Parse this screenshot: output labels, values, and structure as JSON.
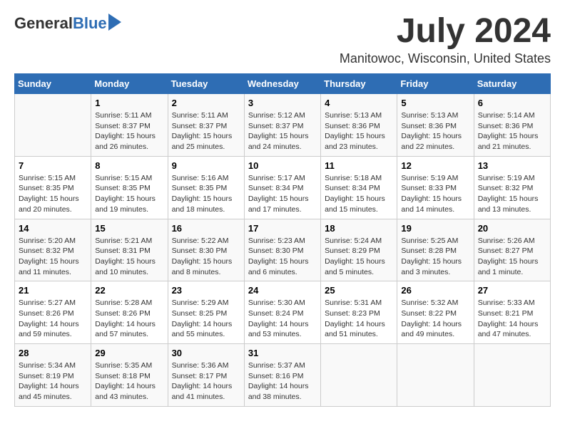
{
  "header": {
    "logo_general": "General",
    "logo_blue": "Blue",
    "month_title": "July 2024",
    "location": "Manitowoc, Wisconsin, United States"
  },
  "weekdays": [
    "Sunday",
    "Monday",
    "Tuesday",
    "Wednesday",
    "Thursday",
    "Friday",
    "Saturday"
  ],
  "weeks": [
    [
      {
        "day": "",
        "sunrise": "",
        "sunset": "",
        "daylight": ""
      },
      {
        "day": "1",
        "sunrise": "Sunrise: 5:11 AM",
        "sunset": "Sunset: 8:37 PM",
        "daylight": "Daylight: 15 hours and 26 minutes."
      },
      {
        "day": "2",
        "sunrise": "Sunrise: 5:11 AM",
        "sunset": "Sunset: 8:37 PM",
        "daylight": "Daylight: 15 hours and 25 minutes."
      },
      {
        "day": "3",
        "sunrise": "Sunrise: 5:12 AM",
        "sunset": "Sunset: 8:37 PM",
        "daylight": "Daylight: 15 hours and 24 minutes."
      },
      {
        "day": "4",
        "sunrise": "Sunrise: 5:13 AM",
        "sunset": "Sunset: 8:36 PM",
        "daylight": "Daylight: 15 hours and 23 minutes."
      },
      {
        "day": "5",
        "sunrise": "Sunrise: 5:13 AM",
        "sunset": "Sunset: 8:36 PM",
        "daylight": "Daylight: 15 hours and 22 minutes."
      },
      {
        "day": "6",
        "sunrise": "Sunrise: 5:14 AM",
        "sunset": "Sunset: 8:36 PM",
        "daylight": "Daylight: 15 hours and 21 minutes."
      }
    ],
    [
      {
        "day": "7",
        "sunrise": "Sunrise: 5:15 AM",
        "sunset": "Sunset: 8:35 PM",
        "daylight": "Daylight: 15 hours and 20 minutes."
      },
      {
        "day": "8",
        "sunrise": "Sunrise: 5:15 AM",
        "sunset": "Sunset: 8:35 PM",
        "daylight": "Daylight: 15 hours and 19 minutes."
      },
      {
        "day": "9",
        "sunrise": "Sunrise: 5:16 AM",
        "sunset": "Sunset: 8:35 PM",
        "daylight": "Daylight: 15 hours and 18 minutes."
      },
      {
        "day": "10",
        "sunrise": "Sunrise: 5:17 AM",
        "sunset": "Sunset: 8:34 PM",
        "daylight": "Daylight: 15 hours and 17 minutes."
      },
      {
        "day": "11",
        "sunrise": "Sunrise: 5:18 AM",
        "sunset": "Sunset: 8:34 PM",
        "daylight": "Daylight: 15 hours and 15 minutes."
      },
      {
        "day": "12",
        "sunrise": "Sunrise: 5:19 AM",
        "sunset": "Sunset: 8:33 PM",
        "daylight": "Daylight: 15 hours and 14 minutes."
      },
      {
        "day": "13",
        "sunrise": "Sunrise: 5:19 AM",
        "sunset": "Sunset: 8:32 PM",
        "daylight": "Daylight: 15 hours and 13 minutes."
      }
    ],
    [
      {
        "day": "14",
        "sunrise": "Sunrise: 5:20 AM",
        "sunset": "Sunset: 8:32 PM",
        "daylight": "Daylight: 15 hours and 11 minutes."
      },
      {
        "day": "15",
        "sunrise": "Sunrise: 5:21 AM",
        "sunset": "Sunset: 8:31 PM",
        "daylight": "Daylight: 15 hours and 10 minutes."
      },
      {
        "day": "16",
        "sunrise": "Sunrise: 5:22 AM",
        "sunset": "Sunset: 8:30 PM",
        "daylight": "Daylight: 15 hours and 8 minutes."
      },
      {
        "day": "17",
        "sunrise": "Sunrise: 5:23 AM",
        "sunset": "Sunset: 8:30 PM",
        "daylight": "Daylight: 15 hours and 6 minutes."
      },
      {
        "day": "18",
        "sunrise": "Sunrise: 5:24 AM",
        "sunset": "Sunset: 8:29 PM",
        "daylight": "Daylight: 15 hours and 5 minutes."
      },
      {
        "day": "19",
        "sunrise": "Sunrise: 5:25 AM",
        "sunset": "Sunset: 8:28 PM",
        "daylight": "Daylight: 15 hours and 3 minutes."
      },
      {
        "day": "20",
        "sunrise": "Sunrise: 5:26 AM",
        "sunset": "Sunset: 8:27 PM",
        "daylight": "Daylight: 15 hours and 1 minute."
      }
    ],
    [
      {
        "day": "21",
        "sunrise": "Sunrise: 5:27 AM",
        "sunset": "Sunset: 8:26 PM",
        "daylight": "Daylight: 14 hours and 59 minutes."
      },
      {
        "day": "22",
        "sunrise": "Sunrise: 5:28 AM",
        "sunset": "Sunset: 8:26 PM",
        "daylight": "Daylight: 14 hours and 57 minutes."
      },
      {
        "day": "23",
        "sunrise": "Sunrise: 5:29 AM",
        "sunset": "Sunset: 8:25 PM",
        "daylight": "Daylight: 14 hours and 55 minutes."
      },
      {
        "day": "24",
        "sunrise": "Sunrise: 5:30 AM",
        "sunset": "Sunset: 8:24 PM",
        "daylight": "Daylight: 14 hours and 53 minutes."
      },
      {
        "day": "25",
        "sunrise": "Sunrise: 5:31 AM",
        "sunset": "Sunset: 8:23 PM",
        "daylight": "Daylight: 14 hours and 51 minutes."
      },
      {
        "day": "26",
        "sunrise": "Sunrise: 5:32 AM",
        "sunset": "Sunset: 8:22 PM",
        "daylight": "Daylight: 14 hours and 49 minutes."
      },
      {
        "day": "27",
        "sunrise": "Sunrise: 5:33 AM",
        "sunset": "Sunset: 8:21 PM",
        "daylight": "Daylight: 14 hours and 47 minutes."
      }
    ],
    [
      {
        "day": "28",
        "sunrise": "Sunrise: 5:34 AM",
        "sunset": "Sunset: 8:19 PM",
        "daylight": "Daylight: 14 hours and 45 minutes."
      },
      {
        "day": "29",
        "sunrise": "Sunrise: 5:35 AM",
        "sunset": "Sunset: 8:18 PM",
        "daylight": "Daylight: 14 hours and 43 minutes."
      },
      {
        "day": "30",
        "sunrise": "Sunrise: 5:36 AM",
        "sunset": "Sunset: 8:17 PM",
        "daylight": "Daylight: 14 hours and 41 minutes."
      },
      {
        "day": "31",
        "sunrise": "Sunrise: 5:37 AM",
        "sunset": "Sunset: 8:16 PM",
        "daylight": "Daylight: 14 hours and 38 minutes."
      },
      {
        "day": "",
        "sunrise": "",
        "sunset": "",
        "daylight": ""
      },
      {
        "day": "",
        "sunrise": "",
        "sunset": "",
        "daylight": ""
      },
      {
        "day": "",
        "sunrise": "",
        "sunset": "",
        "daylight": ""
      }
    ]
  ]
}
